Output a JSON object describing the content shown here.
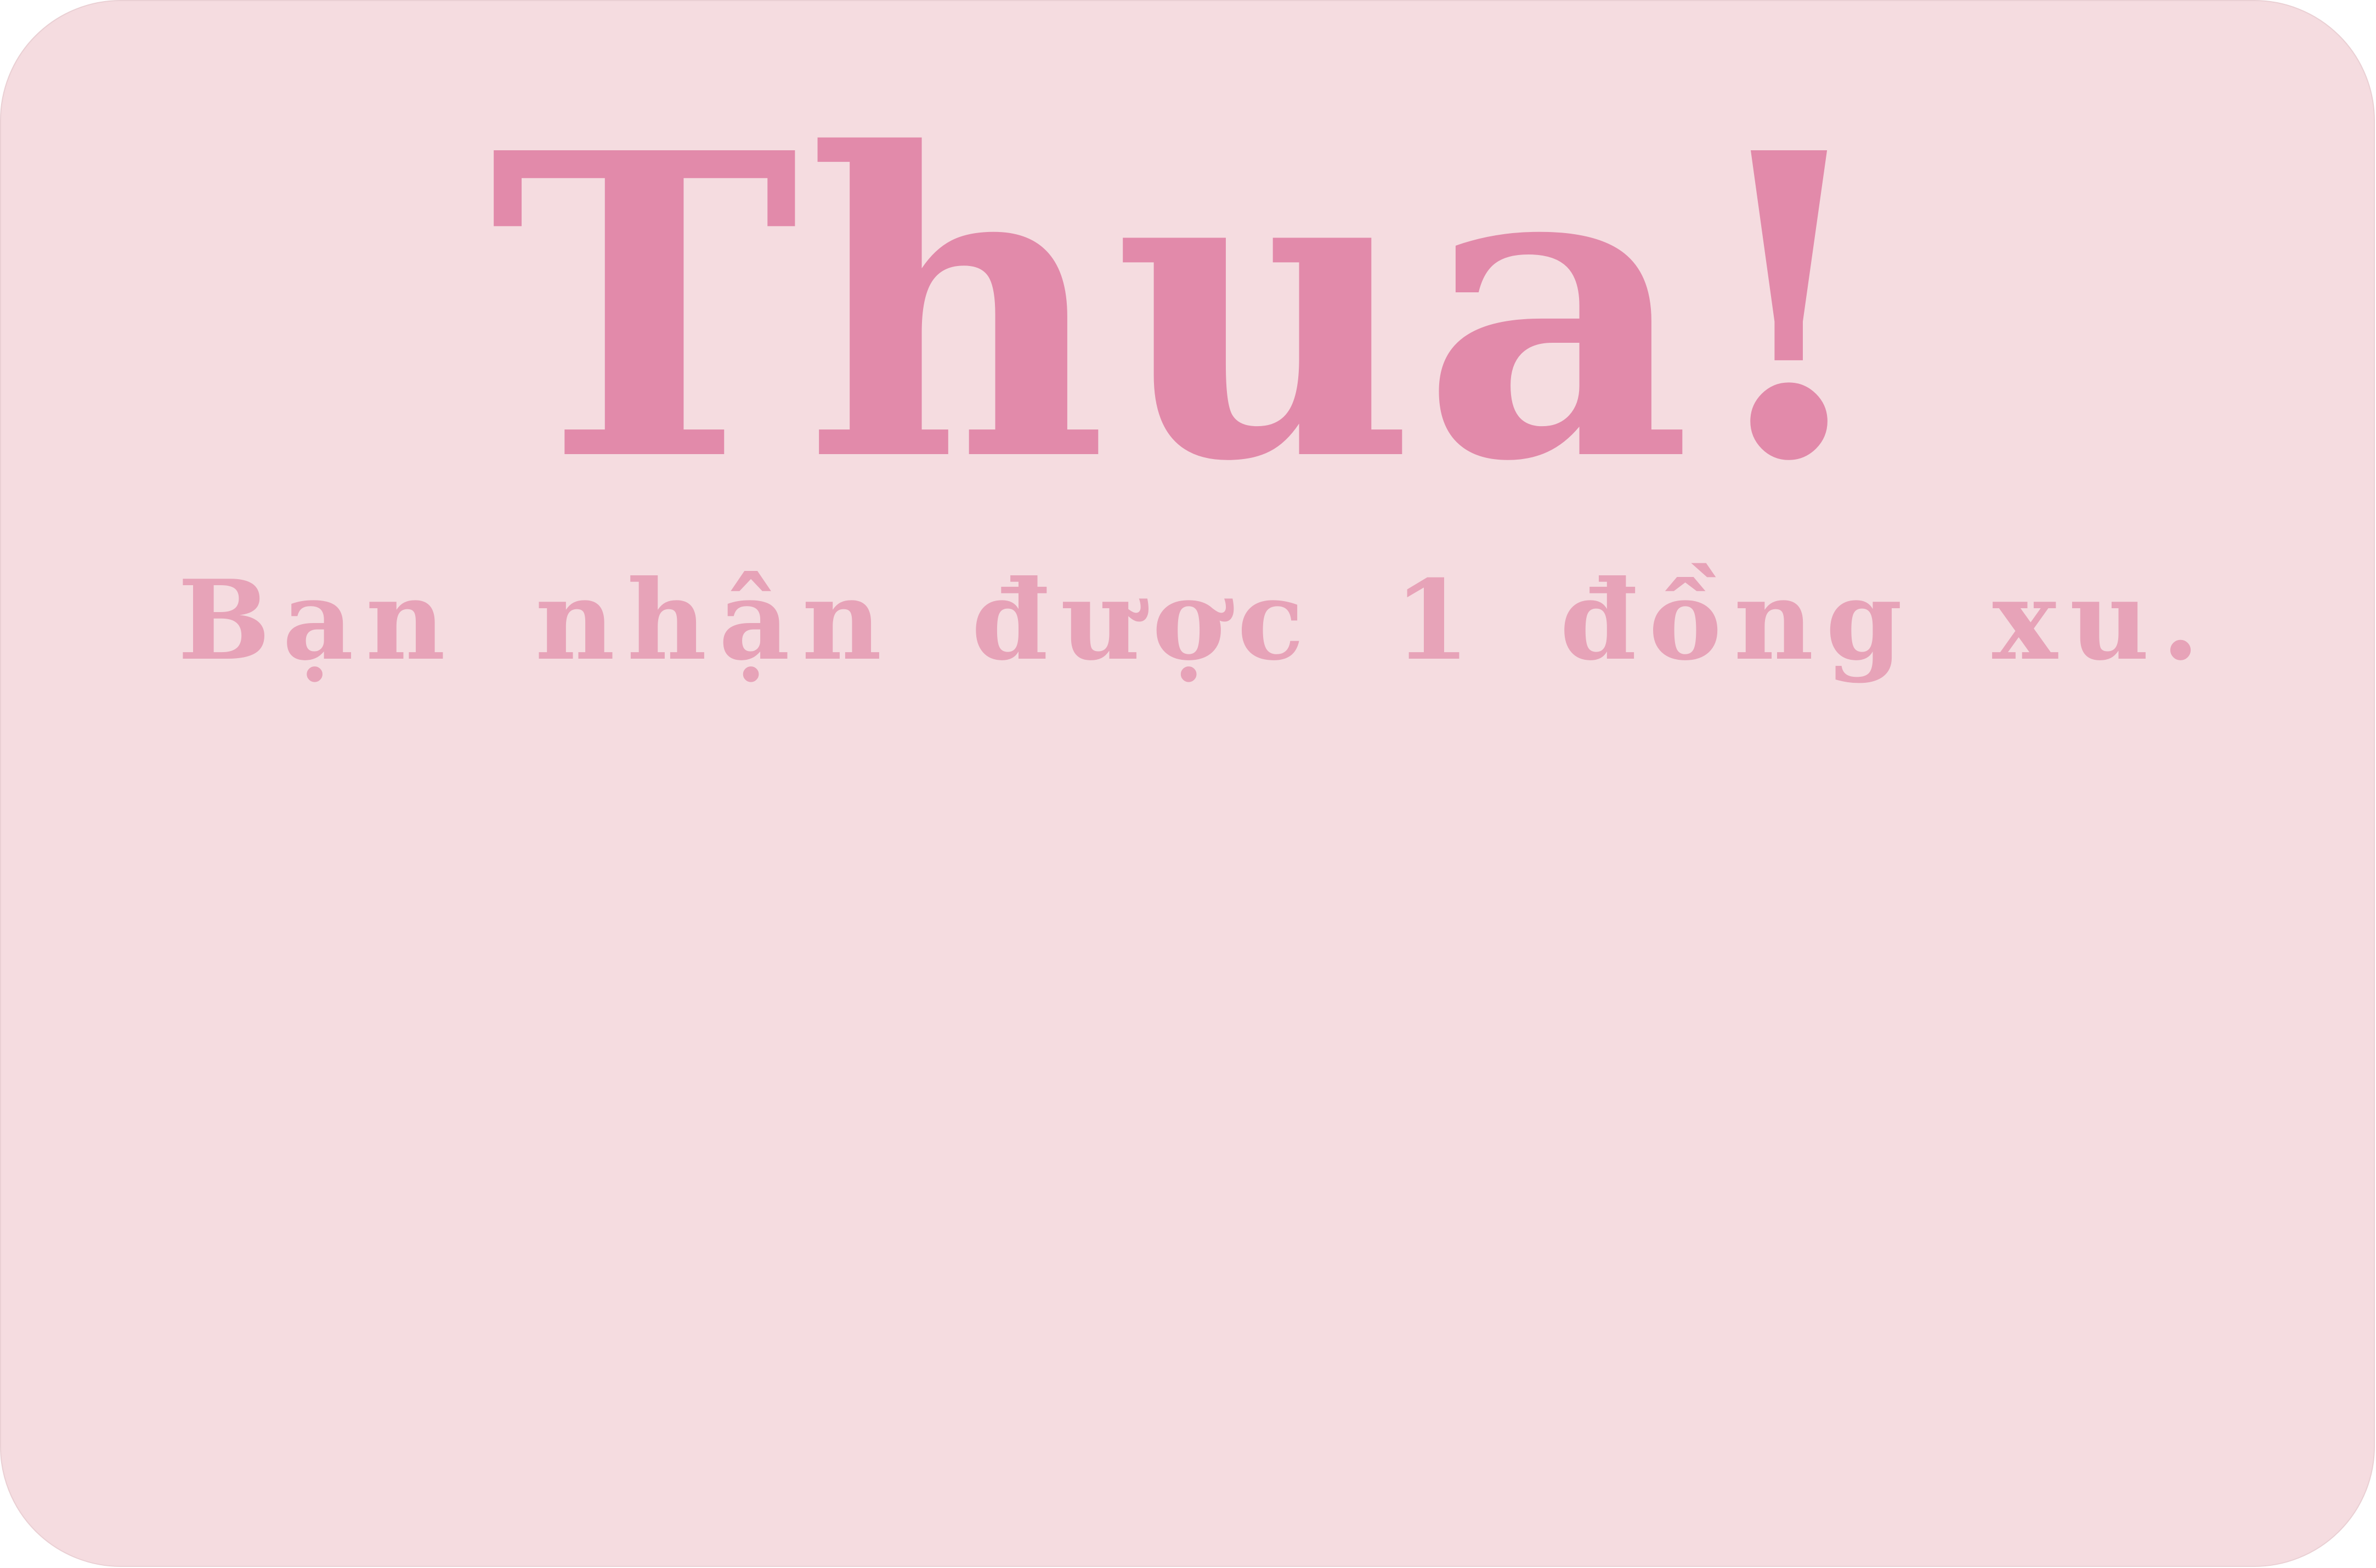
{
  "result": {
    "title": "Thua!",
    "message": "Bạn nhận được 1 đồng xu."
  },
  "colors": {
    "background": "#f5dce0",
    "title": "#e28aaa",
    "message": "#e7a3b8"
  }
}
